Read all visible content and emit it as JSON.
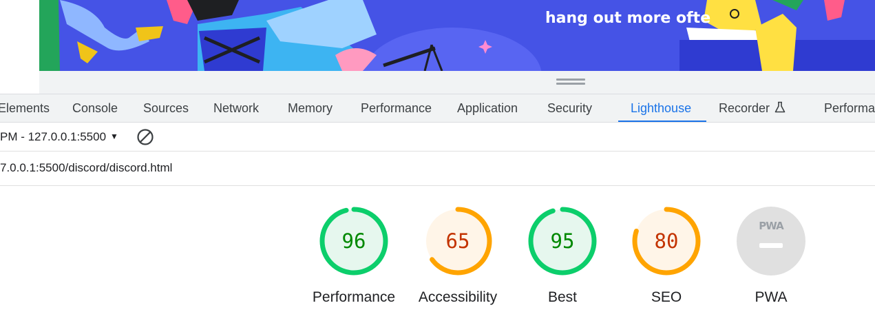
{
  "preview": {
    "banner_text": "hang out more ofte"
  },
  "tabs": [
    {
      "label": "Elements",
      "active": false
    },
    {
      "label": "Console",
      "active": false
    },
    {
      "label": "Sources",
      "active": false
    },
    {
      "label": "Network",
      "active": false
    },
    {
      "label": "Memory",
      "active": false
    },
    {
      "label": "Performance",
      "active": false
    },
    {
      "label": "Application",
      "active": false
    },
    {
      "label": "Security",
      "active": false
    },
    {
      "label": "Lighthouse",
      "active": true
    },
    {
      "label": "Recorder",
      "active": false,
      "icon": "flask-icon"
    },
    {
      "label": "Performa",
      "active": false
    }
  ],
  "toolbar": {
    "report_label": "PM - 127.0.0.1:5500",
    "dropdown_icon": "caret-down-icon",
    "clear_icon": "block-icon"
  },
  "report": {
    "url": "7.0.0.1:5500/discord/discord.html"
  },
  "scores": [
    {
      "label": "Performance",
      "score": "96",
      "value": 96,
      "status": "pass"
    },
    {
      "label": "Accessibility",
      "score": "65",
      "value": 65,
      "status": "average"
    },
    {
      "label": "Best",
      "score": "95",
      "value": 95,
      "status": "pass"
    },
    {
      "label": "SEO",
      "score": "80",
      "value": 80,
      "status": "average"
    },
    {
      "label": "PWA",
      "score": "PWA",
      "value": null,
      "status": "na"
    }
  ],
  "colors": {
    "pass_stroke": "#0cce6b",
    "pass_fill": "#e6f7ee",
    "pass_text": "#008800",
    "average_stroke": "#ffa400",
    "average_fill": "#fff5e8",
    "average_text": "#c33300",
    "na_fill": "#e0e0e0",
    "accent": "#1a73e8"
  }
}
